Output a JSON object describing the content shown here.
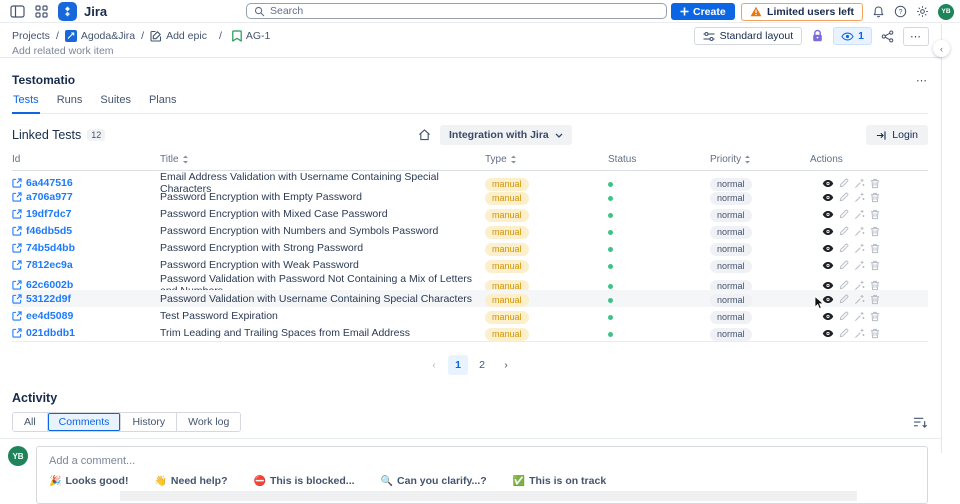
{
  "topbar": {
    "app_name": "Jira",
    "search_placeholder": "Search",
    "create_label": "Create",
    "warning_label": "Limited users left",
    "avatar_initials": "YB"
  },
  "toolbar": {
    "breadcrumbs": [
      "Projects",
      "Agoda&Jira",
      "Add epic",
      "AG-1"
    ],
    "separator": "/",
    "standard_layout_label": "Standard layout",
    "viewers_count": "1",
    "more_glyph": "⋯"
  },
  "content_peek": "Add related work item",
  "rail": {
    "collapse_glyph": "‹"
  },
  "testomatio": {
    "title": "Testomatio",
    "more_glyph": "⋯",
    "tabs": [
      "Tests",
      "Runs",
      "Suites",
      "Plans"
    ],
    "active_tab": "Tests",
    "linked_tests_label": "Linked Tests",
    "linked_tests_count": "12",
    "integration_dropdown": "Integration with Jira",
    "login_label": "Login"
  },
  "table": {
    "columns": [
      {
        "label": "Id",
        "sortable": false
      },
      {
        "label": "Title",
        "sortable": true
      },
      {
        "label": "Type",
        "sortable": true
      },
      {
        "label": "Status",
        "sortable": false
      },
      {
        "label": "Priority",
        "sortable": true
      },
      {
        "label": "Actions",
        "sortable": false
      }
    ],
    "rows": [
      {
        "id": "6a447516",
        "title": "Email Address Validation with Username Containing Special Characters",
        "type": "manual",
        "status": "green",
        "priority": "normal"
      },
      {
        "id": "a706a977",
        "title": "Password Encryption with Empty Password",
        "type": "manual",
        "status": "green",
        "priority": "normal"
      },
      {
        "id": "19df7dc7",
        "title": "Password Encryption with Mixed Case Password",
        "type": "manual",
        "status": "green",
        "priority": "normal"
      },
      {
        "id": "f46db5d5",
        "title": "Password Encryption with Numbers and Symbols Password",
        "type": "manual",
        "status": "green",
        "priority": "normal"
      },
      {
        "id": "74b5d4bb",
        "title": "Password Encryption with Strong Password",
        "type": "manual",
        "status": "green",
        "priority": "normal"
      },
      {
        "id": "7812ec9a",
        "title": "Password Encryption with Weak Password",
        "type": "manual",
        "status": "green",
        "priority": "normal"
      },
      {
        "id": "62c6002b",
        "title": "Password Validation with Password Not Containing a Mix of Letters and Numbers",
        "type": "manual",
        "status": "green",
        "priority": "normal"
      },
      {
        "id": "53122d9f",
        "title": "Password Validation with Username Containing Special Characters",
        "type": "manual",
        "status": "green",
        "priority": "normal"
      },
      {
        "id": "ee4d5089",
        "title": "Test Password Expiration",
        "type": "manual",
        "status": "green",
        "priority": "normal"
      },
      {
        "id": "021dbdb1",
        "title": "Trim Leading and Trailing Spaces from Email Address",
        "type": "manual",
        "status": "green",
        "priority": "normal"
      }
    ],
    "hovered_row_index": 7
  },
  "pagination": {
    "prev_glyph": "‹",
    "next_glyph": "›",
    "pages": [
      "1",
      "2"
    ],
    "current": "1"
  },
  "activity": {
    "title": "Activity",
    "tabs": [
      "All",
      "Comments",
      "History",
      "Work log"
    ],
    "active_tab": "Comments"
  },
  "comment": {
    "avatar_initials": "YB",
    "placeholder": "Add a comment...",
    "quick_replies": [
      {
        "emoji": "🎉",
        "label": "Looks good!"
      },
      {
        "emoji": "👋",
        "label": "Need help?"
      },
      {
        "emoji": "⛔",
        "label": "This is blocked..."
      },
      {
        "emoji": "🔍",
        "label": "Can you clarify...?"
      },
      {
        "emoji": "✅",
        "label": "This is on track"
      }
    ]
  },
  "colors": {
    "accent": "#0C66E4",
    "link_blue": "#1D7AFC",
    "manual_badge_bg": "#FCEFCB",
    "manual_badge_text": "#D29404",
    "status_green": "#3FC28A",
    "priority_badge_bg": "#F0F1F4",
    "warning_orange": "#E8760C",
    "lock_purple": "#7E6BD9",
    "avatar_green": "#1F845A"
  }
}
